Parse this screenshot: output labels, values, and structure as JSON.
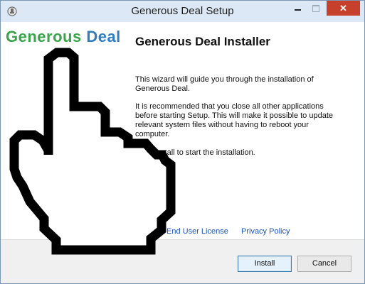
{
  "window": {
    "title": "Generous Deal Setup",
    "close_glyph": "✕",
    "icons": [
      "app-icon",
      "minimize-icon",
      "maximize-icon",
      "close-icon"
    ]
  },
  "brand": {
    "word1": "Generous",
    "word2": "Deal",
    "colors": {
      "word1": "#3aa34a",
      "word2": "#2f7ec1"
    }
  },
  "main": {
    "heading": "Generous Deal Installer",
    "para1": "This wizard will guide you through the installation of Generous Deal.",
    "para2": "It is recommended that you close all other applications before starting Setup. This will make it possible to update relevant system files without having to reboot your computer.",
    "para3": "Click Install to start the installation."
  },
  "links": {
    "eula": "End User License",
    "privacy": "Privacy Policy"
  },
  "buttons": {
    "install": "Install",
    "cancel": "Cancel"
  },
  "overlay": {
    "icon": "hand-pointer-cursor-icon"
  }
}
